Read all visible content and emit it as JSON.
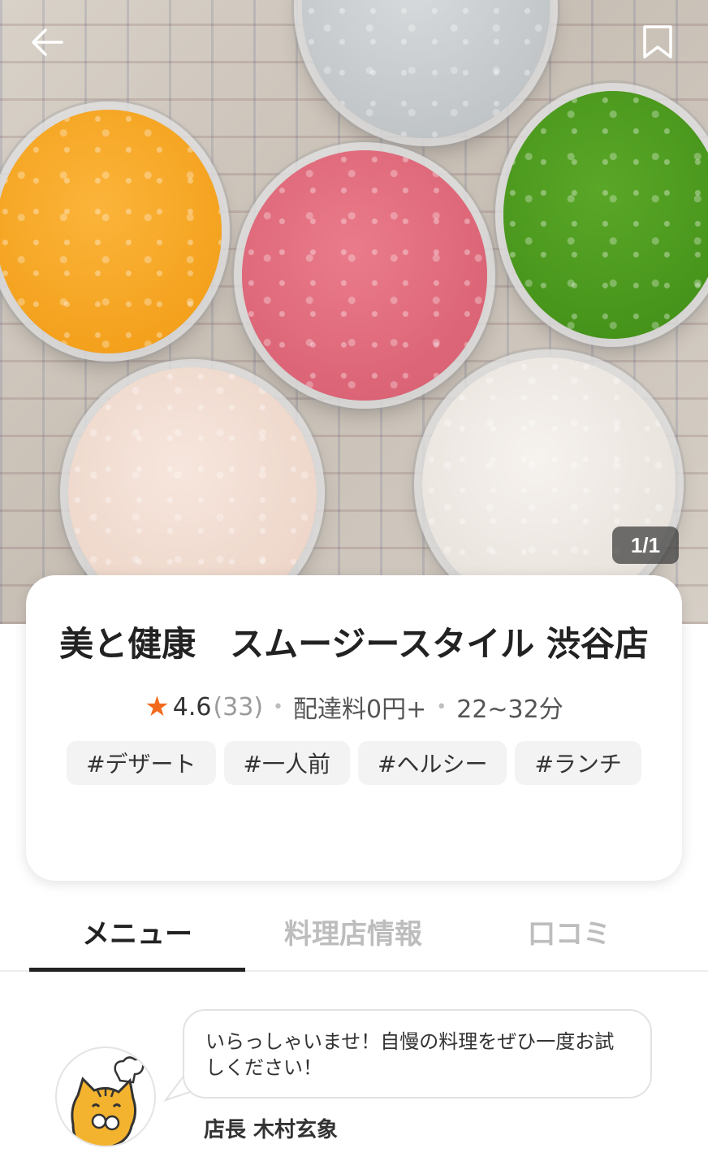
{
  "header": {
    "back_icon": "back-arrow-icon",
    "bookmark_icon": "bookmark-icon",
    "image_counter": "1/1"
  },
  "store": {
    "name": "美と健康　スムージースタイル 渋谷店",
    "rating": "4.6",
    "review_count": "(33)",
    "delivery_fee": "配達料0円+",
    "delivery_time": "22~32分",
    "tags": [
      "#デザート",
      "#一人前",
      "#ヘルシー",
      "#ランチ"
    ]
  },
  "tabs": [
    {
      "label": "メニュー",
      "active": true
    },
    {
      "label": "料理店情報",
      "active": false
    },
    {
      "label": "口コミ",
      "active": false
    }
  ],
  "manager_message": {
    "text": "いらっしゃいませ！自慢の料理をぜひ一度お試しください！",
    "signature": "店長 木村玄象"
  },
  "colors": {
    "accent_star": "#f26a1b",
    "active_tab": "#222222",
    "inactive_tab": "#bdbdbd"
  }
}
